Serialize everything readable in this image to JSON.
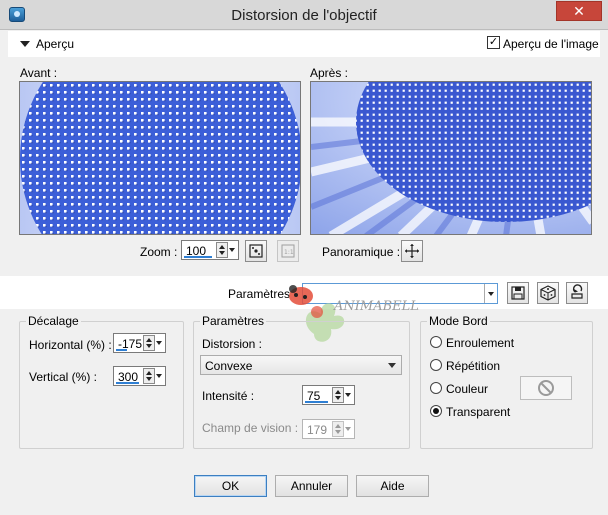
{
  "window": {
    "title": "Distorsion de l'objectif",
    "close_glyph": "✕"
  },
  "preview": {
    "label": "Aperçu",
    "image_label": "Aperçu de l'image",
    "image_checked": true
  },
  "before": {
    "label": "Avant :"
  },
  "after": {
    "label": "Après :"
  },
  "zoom": {
    "label": "Zoom :",
    "value": "100"
  },
  "panoramique": {
    "label": "Panoramique :"
  },
  "params_bar": {
    "label": "Paramètres",
    "value": ""
  },
  "watermark": {
    "text": "ANIMABELLE"
  },
  "decalage": {
    "title": "Décalage",
    "horizontal_label": "Horizontal (%) :",
    "horizontal_value": "-175",
    "vertical_label": "Vertical (%) :",
    "vertical_value": "300"
  },
  "params": {
    "title": "Paramètres",
    "distortion_label": "Distorsion :",
    "distortion_value": "Convexe",
    "intensity_label": "Intensité :",
    "intensity_value": "75",
    "fov_label": "Champ de vision :",
    "fov_value": "179"
  },
  "mode": {
    "title": "Mode Bord",
    "options": [
      "Enroulement",
      "Répétition",
      "Couleur",
      "Transparent"
    ],
    "selected": "Transparent"
  },
  "buttons": {
    "ok": "OK",
    "cancel": "Annuler",
    "help": "Aide"
  },
  "colors": {
    "preview_blue": "#3c5fd8",
    "accent": "#2f7fd3",
    "close_red": "#c7463a"
  }
}
